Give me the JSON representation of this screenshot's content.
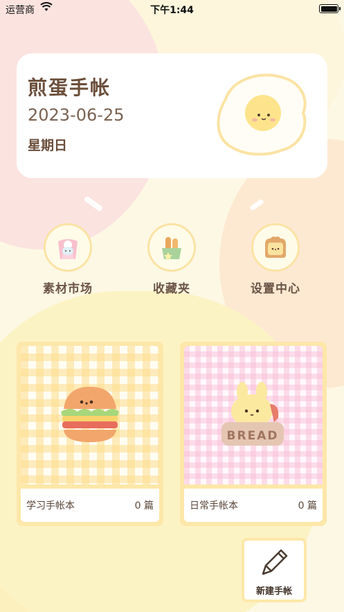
{
  "status_bar": {
    "carrier": "运营商",
    "time": "下午1:44"
  },
  "header": {
    "title": "煎蛋手帐",
    "date": "2023-06-25",
    "weekday": "星期日"
  },
  "menu": {
    "items": [
      {
        "label": "素材市场",
        "icon": "bag-icon"
      },
      {
        "label": "收藏夹",
        "icon": "bread-basket-icon"
      },
      {
        "label": "设置中心",
        "icon": "toast-icon"
      }
    ]
  },
  "notebooks": [
    {
      "name": "学习手帐本",
      "count": "0 篇",
      "cover": "hamburger",
      "color": "#fddc8c"
    },
    {
      "name": "日常手帐本",
      "count": "0 篇",
      "cover": "bread-bunny",
      "color": "#f9bed7"
    }
  ],
  "new_button": {
    "label": "新建手帐",
    "icon": "pencil-icon"
  }
}
